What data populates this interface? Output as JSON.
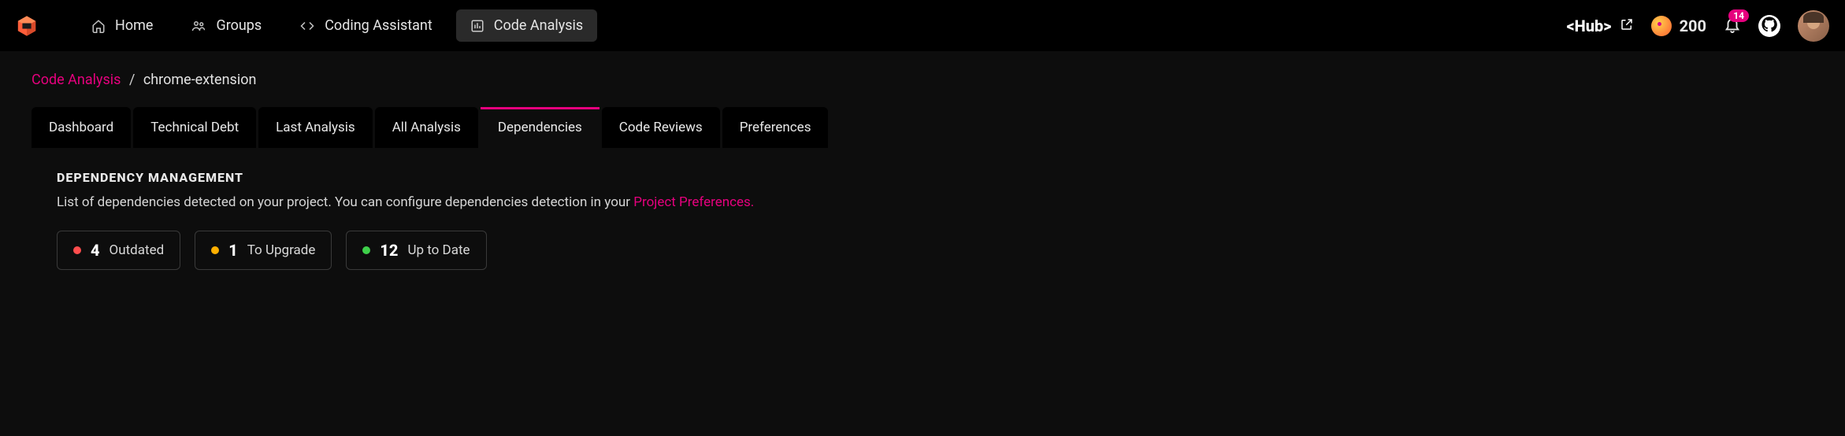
{
  "nav": {
    "items": [
      {
        "label": "Home",
        "active": false
      },
      {
        "label": "Groups",
        "active": false
      },
      {
        "label": "Coding Assistant",
        "active": false
      },
      {
        "label": "Code Analysis",
        "active": true
      }
    ]
  },
  "topbar": {
    "hub_label": "<Hub>",
    "coin_count": "200",
    "notification_count": "14"
  },
  "breadcrumb": {
    "root": "Code Analysis",
    "separator": "/",
    "current": "chrome-extension"
  },
  "tabs": [
    {
      "label": "Dashboard",
      "active": false
    },
    {
      "label": "Technical Debt",
      "active": false
    },
    {
      "label": "Last Analysis",
      "active": false
    },
    {
      "label": "All Analysis",
      "active": false
    },
    {
      "label": "Dependencies",
      "active": true
    },
    {
      "label": "Code Reviews",
      "active": false
    },
    {
      "label": "Preferences",
      "active": false
    }
  ],
  "panel": {
    "title": "Dependency Management",
    "description_prefix": "List of dependencies detected on your project. You can configure dependencies detection in your ",
    "description_link": "Project Preferences."
  },
  "stats": {
    "outdated": {
      "count": "4",
      "label": "Outdated",
      "color": "red"
    },
    "to_upgrade": {
      "count": "1",
      "label": "To Upgrade",
      "color": "orange"
    },
    "up_to_date": {
      "count": "12",
      "label": "Up to Date",
      "color": "green"
    }
  },
  "colors": {
    "accent": "#e6007e",
    "bg": "#0d0d0d",
    "topbar_bg": "#000000"
  }
}
